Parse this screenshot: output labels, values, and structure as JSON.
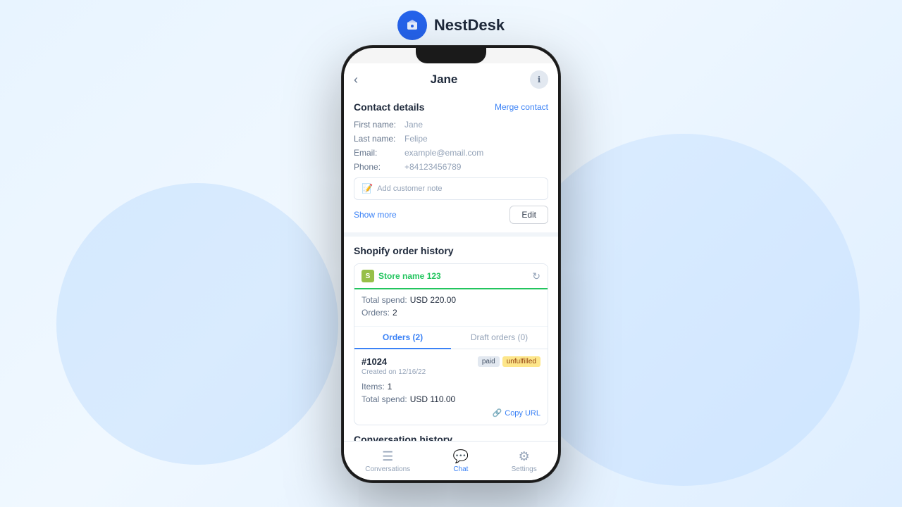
{
  "brand": {
    "name": "NestDesk"
  },
  "header": {
    "back_label": "‹",
    "title": "Jane",
    "info_icon": "ℹ"
  },
  "contact_details": {
    "section_title": "Contact details",
    "merge_label": "Merge contact",
    "fields": [
      {
        "label": "First name:",
        "value": "Jane"
      },
      {
        "label": "Last name:",
        "value": "Felipe"
      },
      {
        "label": "Email:",
        "value": "example@email.com"
      },
      {
        "label": "Phone:",
        "value": "+84123456789"
      }
    ],
    "note_placeholder": "Add customer note",
    "show_more_label": "Show more",
    "edit_label": "Edit"
  },
  "shopify": {
    "section_title": "Shopify order history",
    "store_name": "Store name 123",
    "total_spend_label": "Total spend:",
    "total_spend_value": "USD 220.00",
    "orders_label": "Orders:",
    "orders_count": "2",
    "tab_orders": "Orders (2)",
    "tab_draft": "Draft orders (0)",
    "order": {
      "number": "#1024",
      "created": "Created on 12/16/22",
      "badge_paid": "paid",
      "badge_unfulfilled": "unfulfilled",
      "items_label": "Items:",
      "items_value": "1",
      "total_label": "Total spend:",
      "total_value": "USD 110.00",
      "copy_url_label": "Copy URL"
    }
  },
  "conversation_history": {
    "title": "Conversation history"
  },
  "bottom_nav": [
    {
      "id": "conversations",
      "label": "Conversations",
      "icon": "☰",
      "active": false
    },
    {
      "id": "chat",
      "label": "Chat",
      "icon": "💬",
      "active": true
    },
    {
      "id": "settings",
      "label": "Settings",
      "icon": "⚙",
      "active": false
    }
  ],
  "colors": {
    "accent_blue": "#3b82f6",
    "green": "#22c55e",
    "paid_bg": "#e2e8f0",
    "unfulfilled_bg": "#fde68a"
  }
}
